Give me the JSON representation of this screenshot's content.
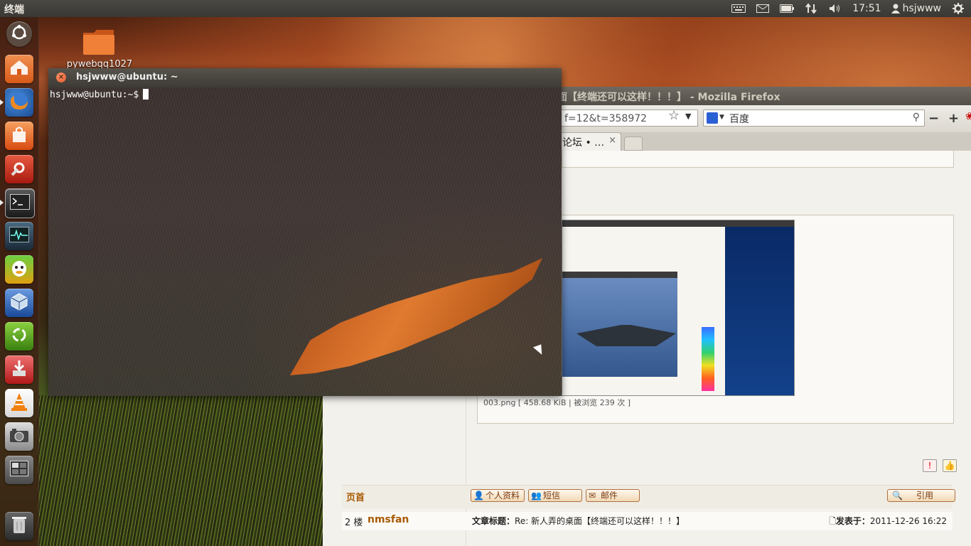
{
  "top_panel": {
    "app_title": "终端",
    "clock": "17:51",
    "username": "hsjwww",
    "icons": [
      "keyboard-icon",
      "mail-icon",
      "battery-icon",
      "network-icon",
      "volume-icon",
      "user-icon",
      "gear-icon"
    ]
  },
  "launcher": {
    "items": [
      {
        "name": "dash-home",
        "icon": "ubuntu-logo-icon",
        "color": "#5a4a40"
      },
      {
        "name": "home-folder",
        "icon": "home-folder-icon",
        "color": "#e86a2a"
      },
      {
        "name": "firefox",
        "icon": "firefox-icon",
        "color": "#2f6fb0"
      },
      {
        "name": "software-center",
        "icon": "shopping-bag-icon",
        "color": "#e85a1a"
      },
      {
        "name": "system-settings",
        "icon": "settings-icon",
        "color": "#c4301a"
      },
      {
        "name": "terminal",
        "icon": "terminal-icon",
        "color": "#2c2c2c"
      },
      {
        "name": "system-monitor",
        "icon": "monitor-icon",
        "color": "#3a5a70"
      },
      {
        "name": "qq",
        "icon": "qq-icon",
        "color": "#e8a020"
      },
      {
        "name": "virtualbox",
        "icon": "cube-icon",
        "color": "#2a5aa8"
      },
      {
        "name": "recycle-app",
        "icon": "recycle-icon",
        "color": "#5aa02a"
      },
      {
        "name": "installer",
        "icon": "download-icon",
        "color": "#c83030"
      },
      {
        "name": "vlc",
        "icon": "vlc-cone-icon",
        "color": "#e87a10"
      },
      {
        "name": "camera",
        "icon": "camera-icon",
        "color": "#8a8a8a"
      },
      {
        "name": "workspace-switcher",
        "icon": "workspace-icon",
        "color": "#6a6a6a"
      },
      {
        "name": "trash",
        "icon": "trash-icon",
        "color": "#4a4a4a"
      }
    ]
  },
  "desktop": {
    "folder_label": "pywebqq1027"
  },
  "terminal": {
    "title": "hsjwww@ubuntu: ~",
    "prompt": "hsjwww@ubuntu:~$"
  },
  "firefox": {
    "title": "面【终端还可以这样！！！】 - Mozilla Firefox",
    "url_fragment": "f=12&t=358972",
    "search_text": "百度",
    "tab_label": "论坛 • …",
    "tab_close": "×",
    "zoom_out": "−",
    "zoom_in": "+",
    "caption": "003.png [ 458.68 KiB | 被浏览 239 次 ]",
    "home_link": "页首",
    "buttons": {
      "profile": "个人资料",
      "pm": "短信",
      "email": "邮件",
      "quote": "引用"
    },
    "post2": {
      "floor": "2 楼",
      "author": "nmsfan",
      "subject_label": "文章标题：",
      "subject": "Re: 新人弄的桌面【终端还可以这样！！！】",
      "posted_label": "发表于：",
      "posted": "2011-12-26 16:22"
    }
  }
}
